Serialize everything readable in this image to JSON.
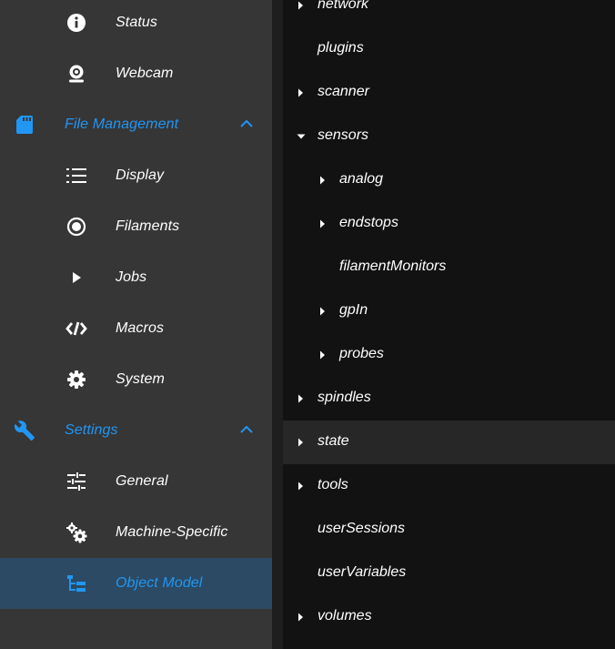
{
  "sidebar": {
    "status_label": "Status",
    "webcam_label": "Webcam",
    "file_management": {
      "label": "File Management",
      "display_label": "Display",
      "filaments_label": "Filaments",
      "jobs_label": "Jobs",
      "macros_label": "Macros",
      "system_label": "System"
    },
    "settings": {
      "label": "Settings",
      "general_label": "General",
      "machine_specific_label": "Machine-Specific",
      "object_model_label": "Object Model"
    }
  },
  "tree": {
    "network": "network",
    "plugins": "plugins",
    "scanner": "scanner",
    "sensors": "sensors",
    "analog": "analog",
    "endstops": "endstops",
    "filamentMonitors": "filamentMonitors",
    "gpIn": "gpIn",
    "probes": "probes",
    "spindles": "spindles",
    "state": "state",
    "tools": "tools",
    "userSessions": "userSessions",
    "userVariables": "userVariables",
    "volumes": "volumes"
  },
  "colors": {
    "accent": "#2196f3",
    "sidebar_bg": "#363636",
    "tree_bg": "#121212",
    "active_bg": "#2c4a63",
    "highlight_row": "#272727"
  }
}
